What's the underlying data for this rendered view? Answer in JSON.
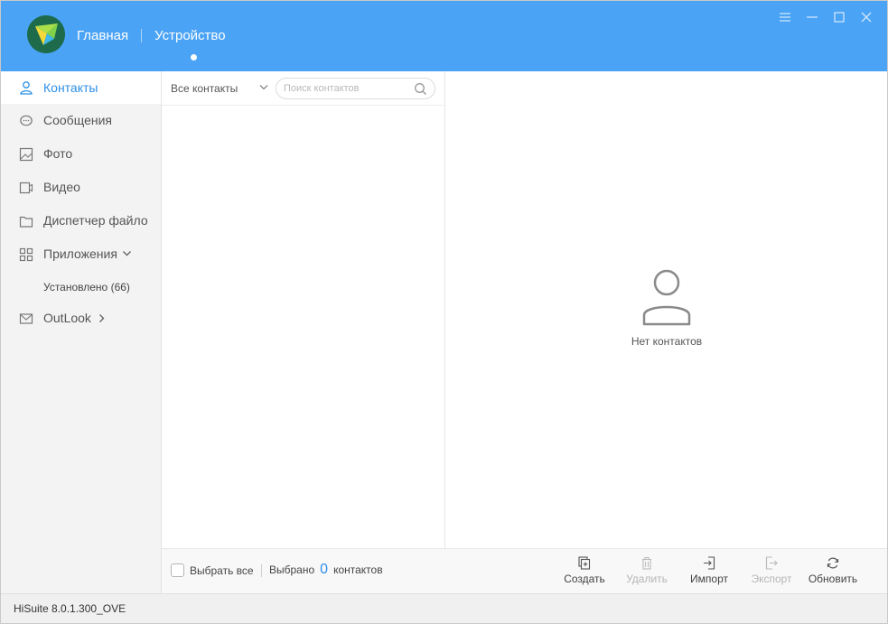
{
  "header": {
    "nav": [
      {
        "label": "Главная"
      },
      {
        "label": "Устройство"
      }
    ],
    "window_controls": [
      {
        "icon": "menu-icon"
      },
      {
        "icon": "minimize-icon"
      },
      {
        "icon": "maximize-icon"
      },
      {
        "icon": "close-icon"
      }
    ],
    "accent_color": "#4aa3f5"
  },
  "sidebar": {
    "items": [
      {
        "label": "Контакты",
        "icon": "person-icon",
        "active": true
      },
      {
        "label": "Сообщения",
        "icon": "chat-bubble-icon"
      },
      {
        "label": "Фото",
        "icon": "image-icon"
      },
      {
        "label": "Видео",
        "icon": "video-icon"
      },
      {
        "label": "Диспетчер файло",
        "icon": "folder-icon"
      },
      {
        "label": "Приложения",
        "icon": "apps-grid-icon"
      },
      {
        "label": "OutLook",
        "icon": "mail-icon"
      }
    ],
    "apps_sub": "Установлено (66)"
  },
  "contacts": {
    "filter_label": "Все контакты",
    "search_placeholder": "Поиск контактов",
    "empty_text": "Нет контактов"
  },
  "bottom_bar": {
    "select_all": "Выбрать все",
    "selected_prefix": "Выбрано",
    "selected_count": "0",
    "selected_suffix": "контактов",
    "tools": [
      {
        "label": "Создать",
        "icon": "create-icon",
        "enabled": true
      },
      {
        "label": "Удалить",
        "icon": "delete-icon",
        "enabled": false
      },
      {
        "label": "Импорт",
        "icon": "import-icon",
        "enabled": true
      },
      {
        "label": "Экспорт",
        "icon": "export-icon",
        "enabled": false
      },
      {
        "label": "Обновить",
        "icon": "refresh-icon",
        "enabled": true
      }
    ]
  },
  "status": {
    "version": "HiSuite 8.0.1.300_OVE"
  }
}
